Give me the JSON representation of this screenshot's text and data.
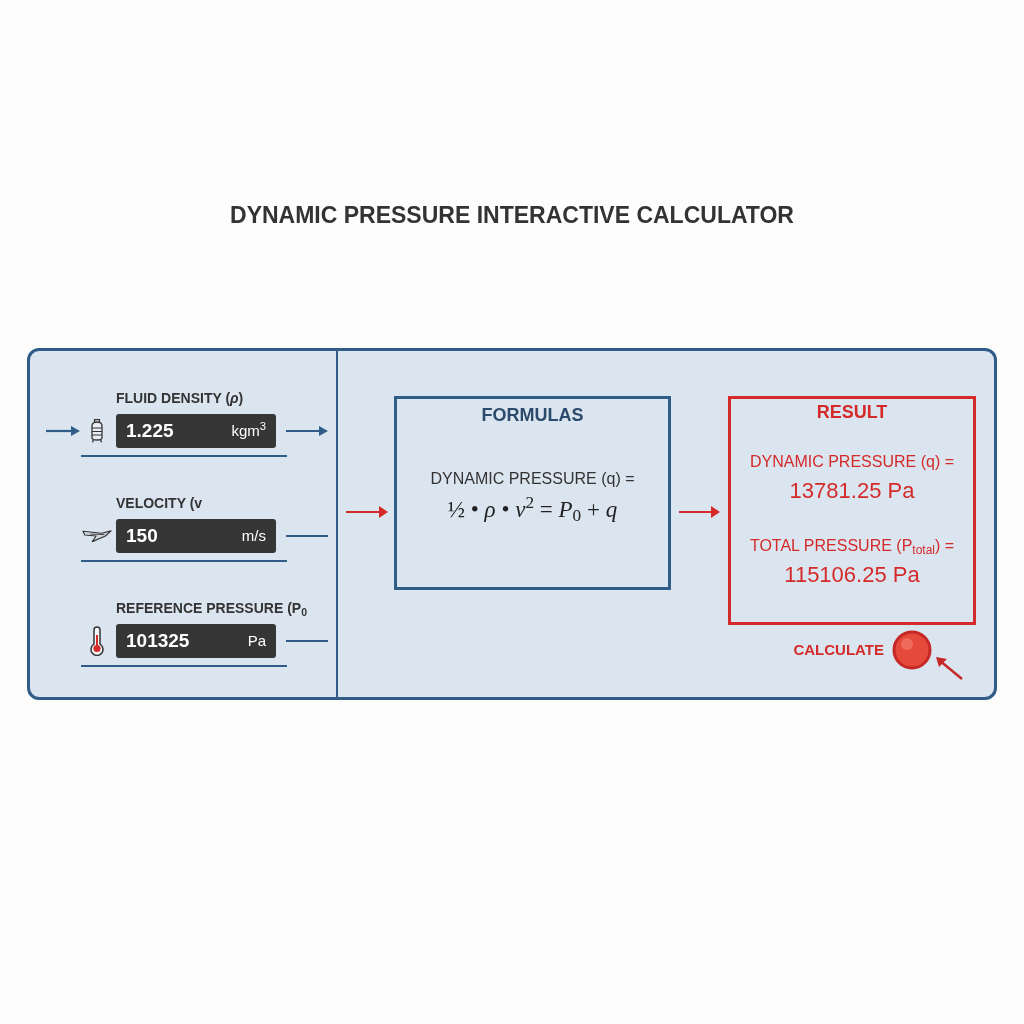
{
  "title": "DYNAMIC PRESSURE INTERACTIVE CALCULATOR",
  "inputs": [
    {
      "kind": "tank",
      "label": "FLUID DENSITY (*ρ*)",
      "value": "1.225",
      "unit": "kgm$^{3}$",
      "arrow_in": true,
      "arrow_out": true
    },
    {
      "kind": "wing",
      "label": "VELOCITY (v",
      "value": "150",
      "unit": "m/s",
      "arrow_in": false,
      "arrow_out": false
    },
    {
      "kind": "thermometer",
      "label": "REFERENCE PRESSURE (P$_{0}$",
      "value": "101325",
      "unit": "Pa",
      "arrow_in": false,
      "arrow_out": false
    }
  ],
  "formulas": {
    "title": "FORMULAS",
    "label": "DYNAMIC PRESSURE (q) =",
    "equation": "½ • *ρ* • *v*$^{2}$ = *P*$_{0}$ + *q*"
  },
  "result": {
    "title": "RESULT",
    "items": [
      {
        "label": "DYNAMIC PRESSURE (q) =",
        "value": "13781.25 Pa"
      },
      {
        "label": "TOTAL PRESSURE (P$_{total}$) =",
        "value": "115106.25 Pa"
      }
    ]
  },
  "calculate": {
    "label": "CALCULATE"
  }
}
